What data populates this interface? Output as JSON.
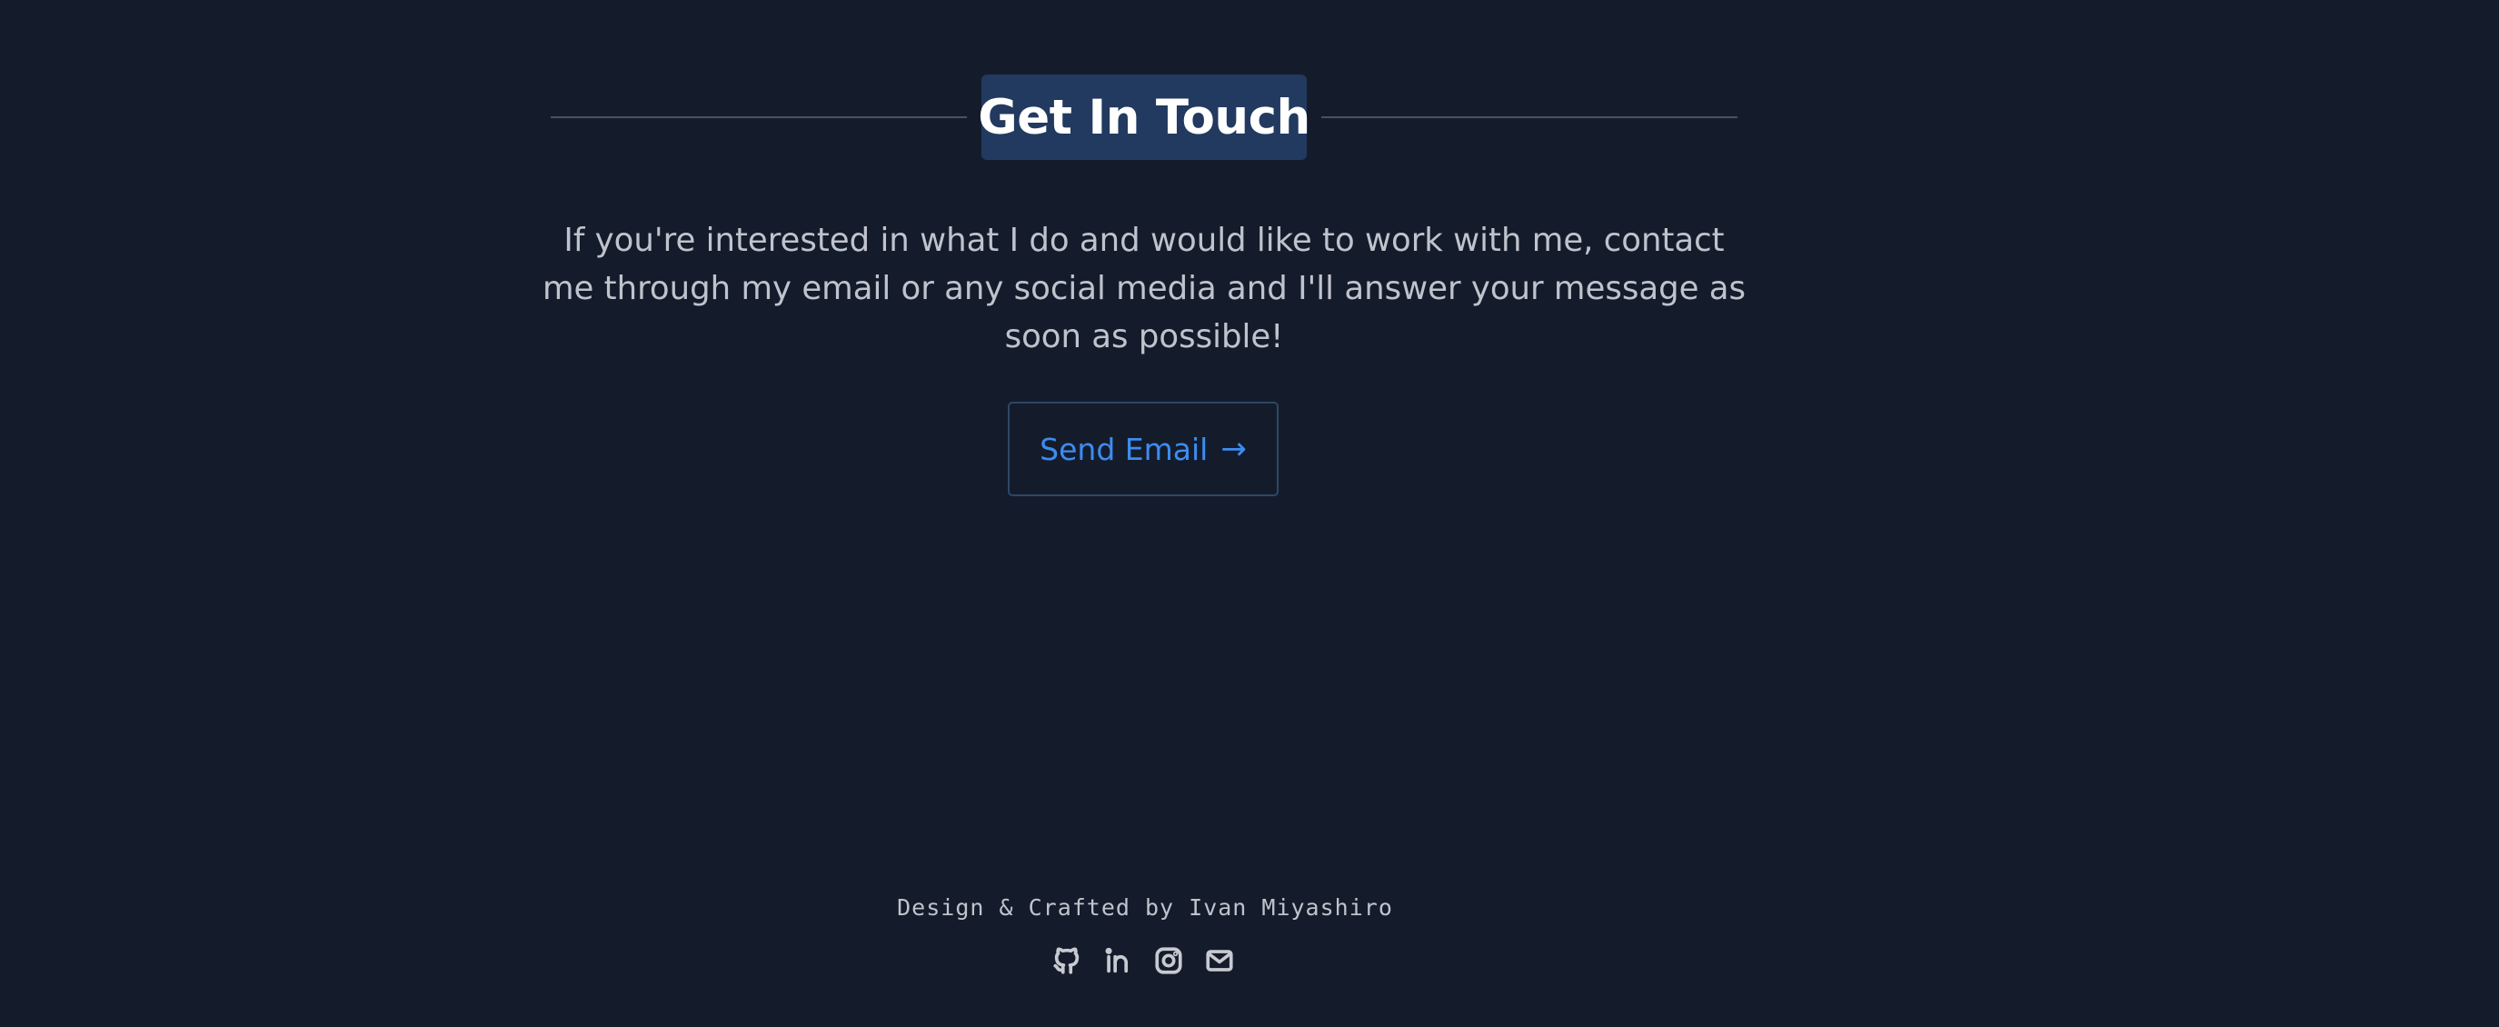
{
  "contact": {
    "title": "Get In Touch",
    "message": "If you're interested in what I do and would like to work with me, contact me through my email or any social media and I'll answer your message as soon as possible!",
    "email_button": {
      "label": "Send Email",
      "icon": "arrow-right-icon"
    }
  },
  "footer": {
    "credit": "Design & Crafted by Ivan Miyashiro",
    "social_icons": [
      "github-icon",
      "linkedin-icon",
      "instagram-icon",
      "mail-icon"
    ]
  },
  "colors": {
    "background": "#141c2b",
    "title_box": "#223a5f",
    "accent": "#3d8cf0",
    "text": "#bfc3cc"
  }
}
